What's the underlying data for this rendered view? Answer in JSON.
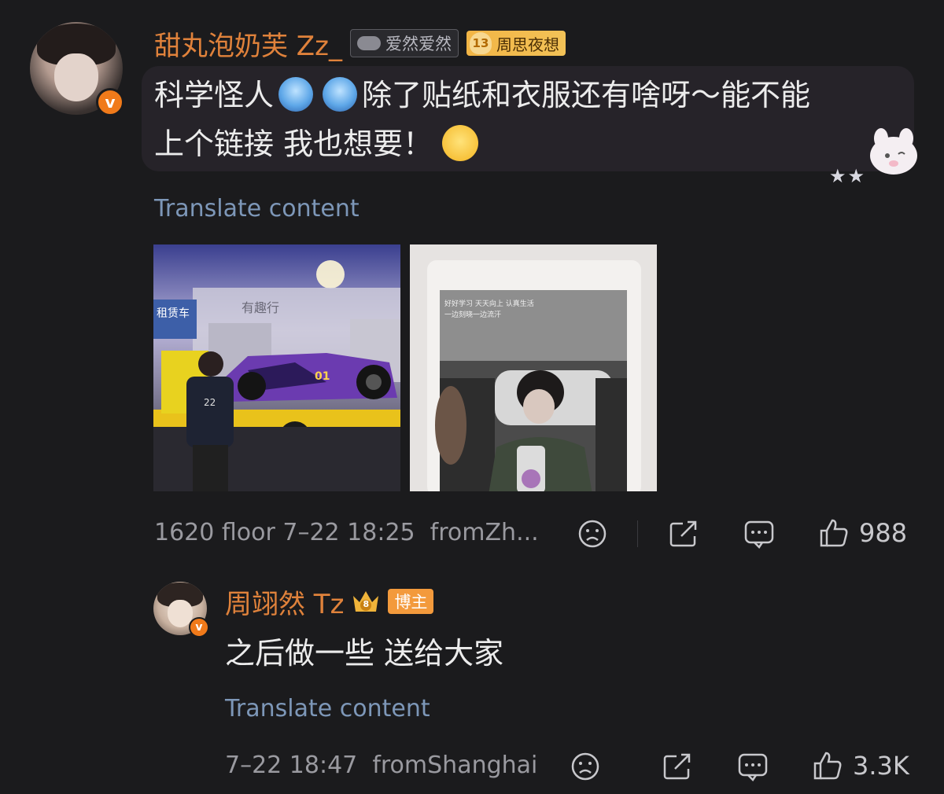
{
  "comment": {
    "username": "甜丸泡奶芙 Zz_",
    "tag_label": "爱然爱然",
    "fan_badge": {
      "level": "13",
      "label": "周思夜想"
    },
    "text_line1_part1": "科学怪人",
    "text_line1_part2": "除了贴纸和衣服还有啥呀～能不能",
    "text_line2": "上个链接 我也想要！",
    "translate_label": "Translate content",
    "photo_texts": {
      "car_sign": "有趣行",
      "car_sign_left": "租赁车",
      "shirt_number": "22",
      "car_number": "01",
      "mirror_caption_line1": "好好学习 天天向上 认真生活",
      "mirror_caption_line2": "一边刻晓一边流汗"
    },
    "meta": "1620 floor 7–22 18:25  fromZh...",
    "likes": "988",
    "icons": [
      "dislike-face-icon",
      "share-icon",
      "comment-icon",
      "thumbs-up-icon"
    ]
  },
  "reply": {
    "username": "周翊然 Tz",
    "host_badge": "博主",
    "crown_level": "8",
    "text": "之后做一些 送给大家",
    "translate_label": "Translate content",
    "meta": "7–22 18:47  fromShanghai",
    "likes": "3.3K"
  },
  "colors": {
    "background": "#1b1b1d",
    "username": "#e0823b",
    "translate": "#7d97b8",
    "verified": "#f07a1a"
  }
}
